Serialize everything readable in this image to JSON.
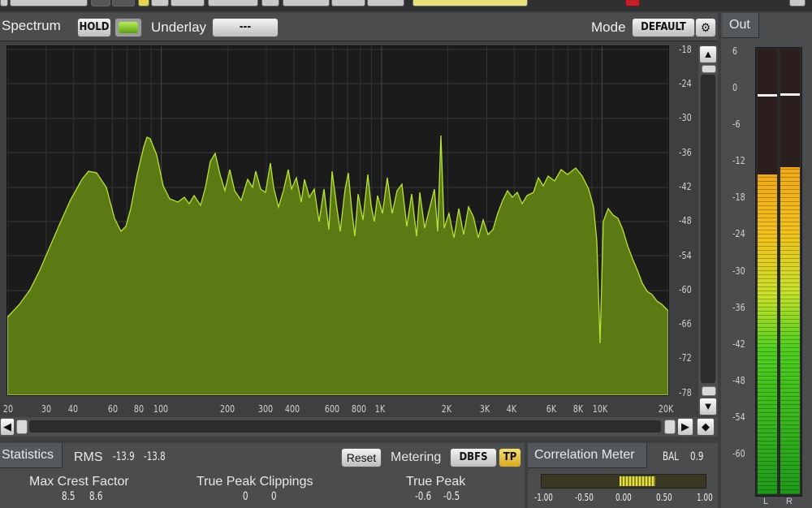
{
  "spectrum": {
    "title": "Spectrum",
    "hold_label": "HOLD",
    "underlay_label": "Underlay",
    "underlay_value": "---",
    "mode_label": "Mode",
    "mode_value": "DEFAULT",
    "y_axis_labels": [
      "-18",
      "-24",
      "-30",
      "-36",
      "-42",
      "-48",
      "-54",
      "-60",
      "-66",
      "-72",
      "-78"
    ],
    "x_axis_labels": [
      "20",
      "30",
      "40",
      "60",
      "80",
      "100",
      "200",
      "300",
      "400",
      "600",
      "800",
      "1K",
      "2K",
      "3K",
      "4K",
      "6K",
      "8K",
      "10K",
      "20K"
    ],
    "colors": {
      "fill": "#5b7a14",
      "line": "#b9e23a",
      "background": "#1b1b1b",
      "grid": "#3a3a3a"
    }
  },
  "statistics": {
    "title": "Statistics",
    "rms_label": "RMS",
    "rms_values": [
      "-13.9",
      "-13.8"
    ],
    "reset_label": "Reset",
    "metering_label": "Metering",
    "metering_value": "DBFS",
    "tp_label": "TP",
    "max_crest_label": "Max Crest Factor",
    "max_crest_values": [
      "8.5",
      "8.6"
    ],
    "tp_clip_label": "True Peak Clippings",
    "tp_clip_values": [
      "0",
      "0"
    ],
    "true_peak_label": "True Peak",
    "true_peak_values": [
      "-0.6",
      "-0.5"
    ]
  },
  "correlation": {
    "title": "Correlation Meter",
    "bal_label": "BAL",
    "bal_value": "0.9",
    "scale_labels": [
      "-1.00",
      "-0.50",
      "0.00",
      "0.50",
      "1.00"
    ]
  },
  "out": {
    "title": "Out",
    "scale_labels": [
      "6",
      "0",
      "-6",
      "-12",
      "-18",
      "-24",
      "-30",
      "-36",
      "-42",
      "-48",
      "-54",
      "-60"
    ],
    "channel_labels": [
      "L",
      "R"
    ],
    "level_left_db": -12.5,
    "level_right_db": -11.5,
    "peak_left_db": -0.6,
    "peak_right_db": -0.5
  }
}
